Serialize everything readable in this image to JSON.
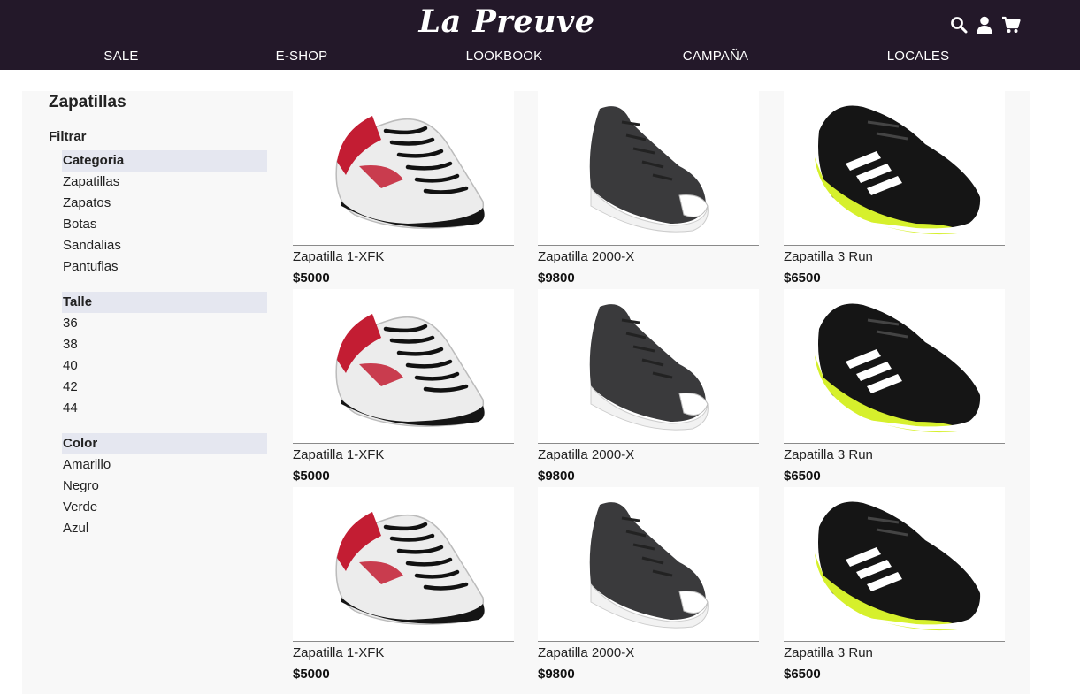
{
  "header": {
    "brand": "La Preuve",
    "icons": [
      "search-icon",
      "user-icon",
      "cart-icon"
    ],
    "nav": [
      "SALE",
      "E-SHOP",
      "LOOKBOOK",
      "CAMPAÑA",
      "LOCALES"
    ],
    "bg_color": "#231829"
  },
  "sidebar": {
    "title": "Zapatillas",
    "filter_label": "Filtrar",
    "groups": [
      {
        "title": "Categoria",
        "items": [
          "Zapatillas",
          "Zapatos",
          "Botas",
          "Sandalias",
          "Pantuflas"
        ]
      },
      {
        "title": "Talle",
        "items": [
          "36",
          "38",
          "40",
          "42",
          "44"
        ]
      },
      {
        "title": "Color",
        "items": [
          "Amarillo",
          "Negro",
          "Verde",
          "Azul"
        ]
      }
    ]
  },
  "products": [
    {
      "name": "Zapatilla 1-XFK",
      "price": "$5000",
      "image": "white-red-tennis-shoe"
    },
    {
      "name": "Zapatilla 2000-X",
      "price": "$9800",
      "image": "dark-gray-high-top-sneaker"
    },
    {
      "name": "Zapatilla 3 Run",
      "price": "$6500",
      "image": "black-yellow-running-shoe"
    },
    {
      "name": "Zapatilla 1-XFK",
      "price": "$5000",
      "image": "white-red-tennis-shoe"
    },
    {
      "name": "Zapatilla 2000-X",
      "price": "$9800",
      "image": "dark-gray-high-top-sneaker"
    },
    {
      "name": "Zapatilla 3 Run",
      "price": "$6500",
      "image": "black-yellow-running-shoe"
    },
    {
      "name": "Zapatilla 1-XFK",
      "price": "$5000",
      "image": "white-red-tennis-shoe"
    },
    {
      "name": "Zapatilla 2000-X",
      "price": "$9800",
      "image": "dark-gray-high-top-sneaker"
    },
    {
      "name": "Zapatilla 3 Run",
      "price": "$6500",
      "image": "black-yellow-running-shoe"
    }
  ]
}
